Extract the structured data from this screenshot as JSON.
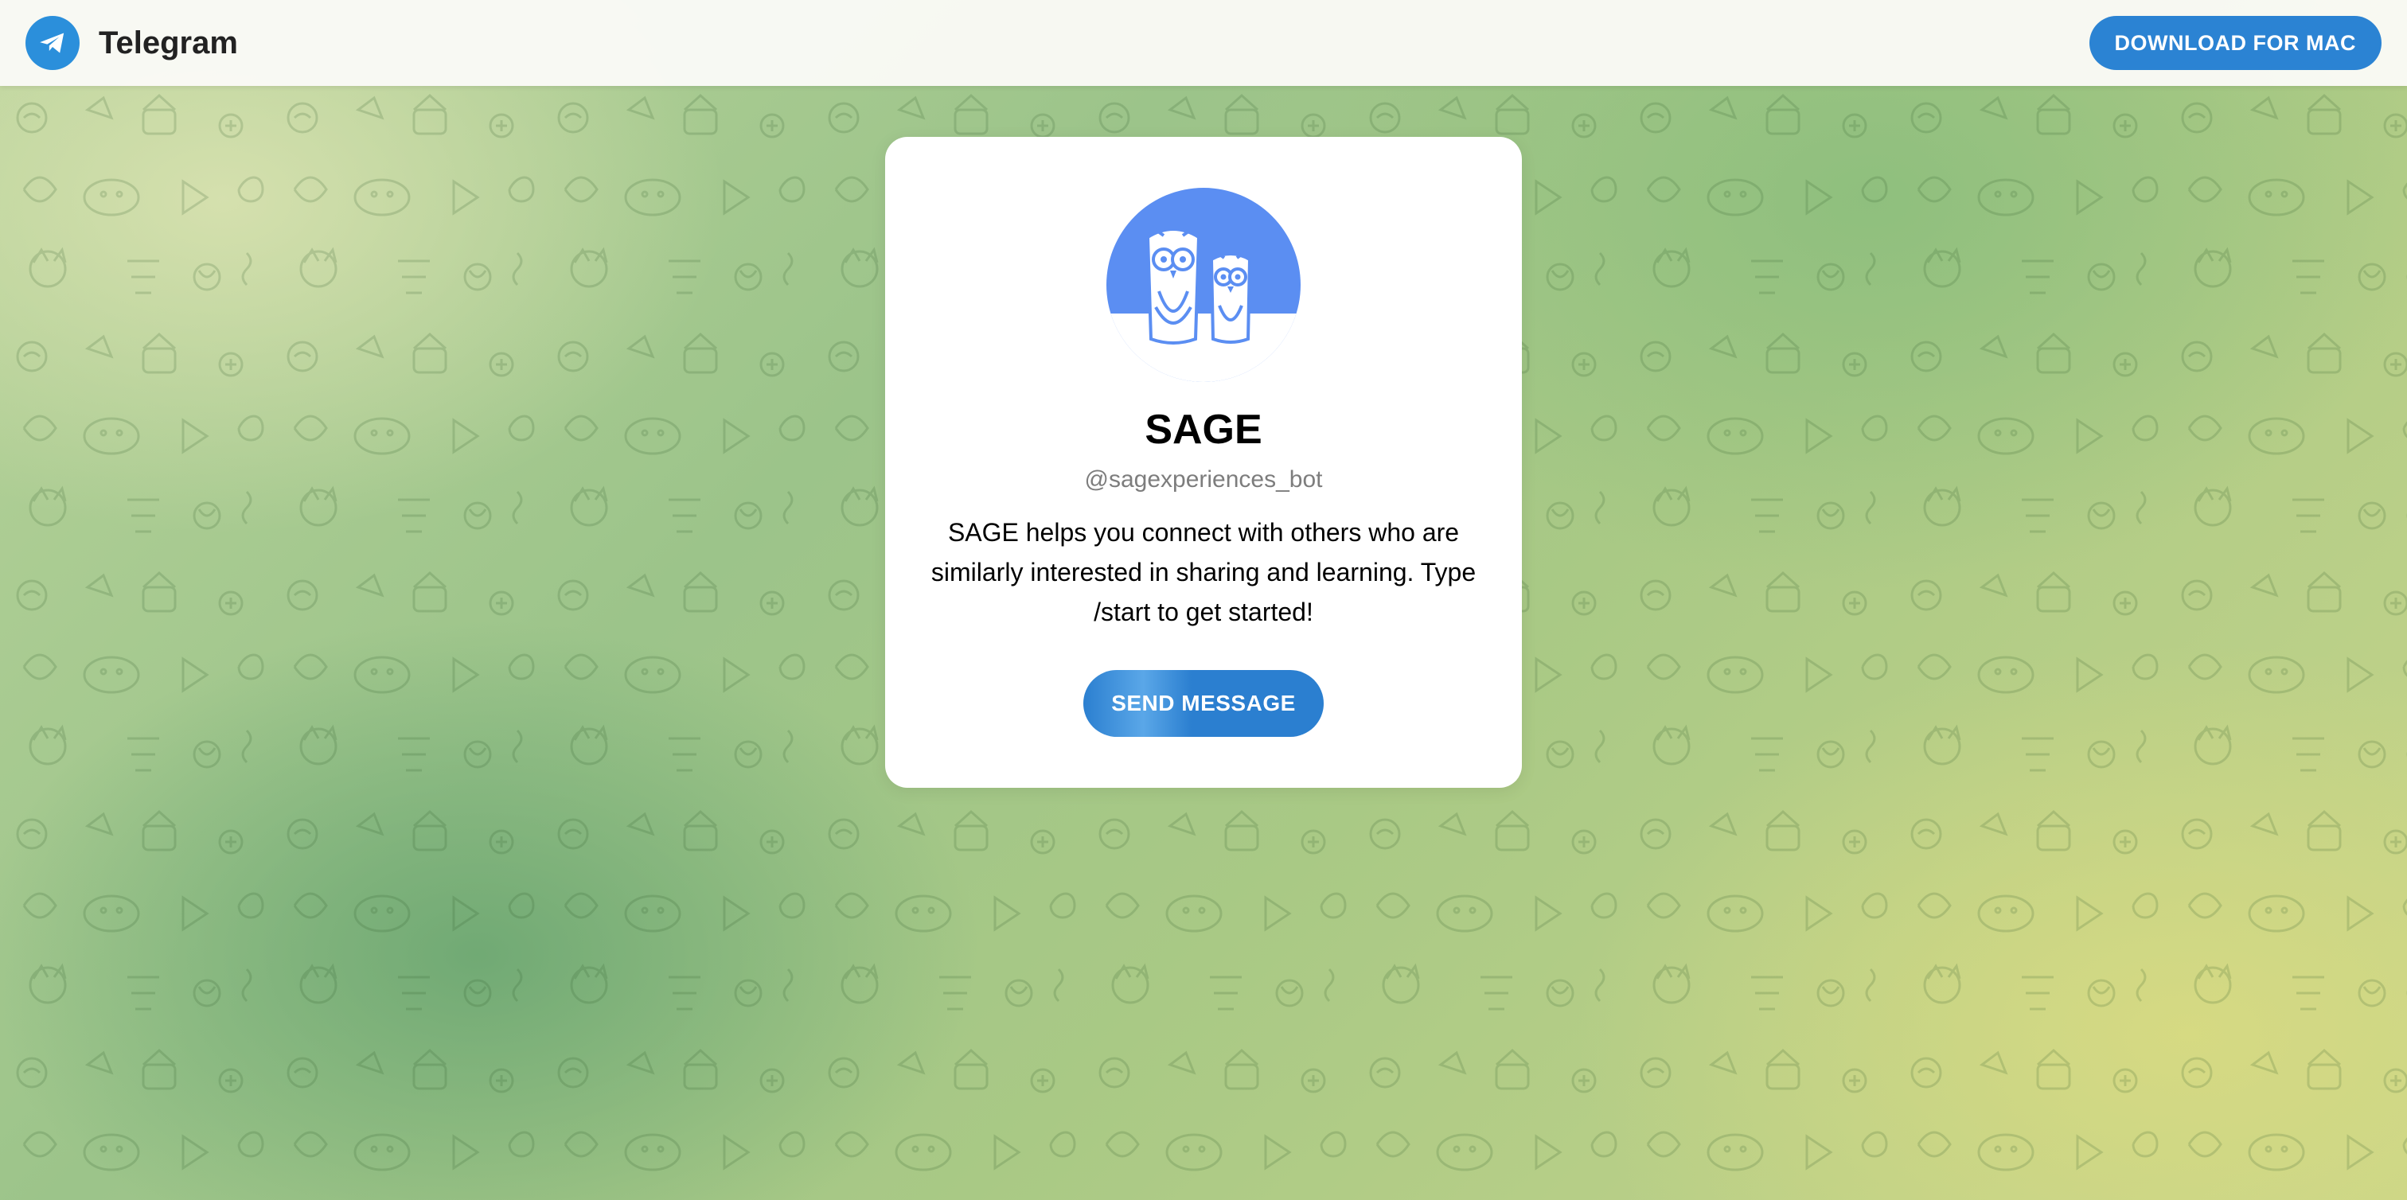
{
  "header": {
    "brand": "Telegram",
    "download_label": "DOWNLOAD FOR MAC"
  },
  "card": {
    "title": "SAGE",
    "username": "@sagexperiences_bot",
    "description": "SAGE helps you connect with others who are similarly interested in sharing and learning. Type /start to get started!",
    "send_label": "SEND MESSAGE"
  },
  "colors": {
    "accent": "#2b83d3",
    "avatar_bg": "#5b8ef2"
  },
  "icons": {
    "logo": "telegram-plane-icon",
    "avatar": "owls-icon"
  }
}
